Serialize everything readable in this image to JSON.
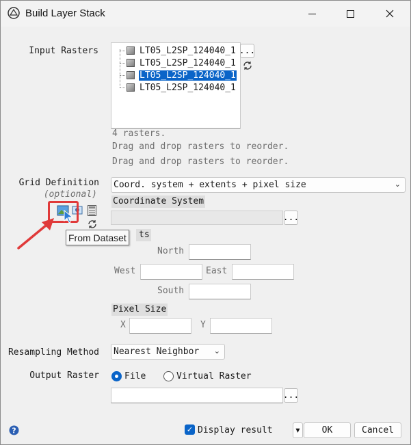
{
  "window": {
    "title": "Build Layer Stack"
  },
  "input_rasters": {
    "label": "Input Rasters",
    "items": [
      {
        "name": "LT05_L2SP_124040_1",
        "selected": false
      },
      {
        "name": "LT05_L2SP_124040_1",
        "selected": false
      },
      {
        "name": "LT05_L2SP_124040_1",
        "selected": true
      },
      {
        "name": "LT05_L2SP_124040_1",
        "selected": false
      }
    ],
    "browse_label": "...",
    "count_text": "4 rasters.",
    "hint1": "Drag and drop rasters to reorder.",
    "hint2": "Drag and drop rasters to reorder."
  },
  "grid": {
    "label": "Grid Definition",
    "optional": "(optional)",
    "mode": "Coord. system + extents + pixel size",
    "coord_system_head": "Coordinate System",
    "coord_browse": "...",
    "extents_head_visible": "ts",
    "north": "North",
    "west": "West",
    "east": "East",
    "south": "South",
    "pixel_size_head": "Pixel Size",
    "x": "X",
    "y": "Y",
    "tooltip": "From Dataset"
  },
  "resampling": {
    "label": "Resampling Method",
    "value": "Nearest Neighbor"
  },
  "output": {
    "label": "Output Raster",
    "file": "File",
    "virtual": "Virtual Raster",
    "browse": "..."
  },
  "footer": {
    "display_result": "Display result",
    "ok": "OK",
    "cancel": "Cancel"
  },
  "colors": {
    "accent": "#0a64c8",
    "annotation": "#e03a3a"
  }
}
